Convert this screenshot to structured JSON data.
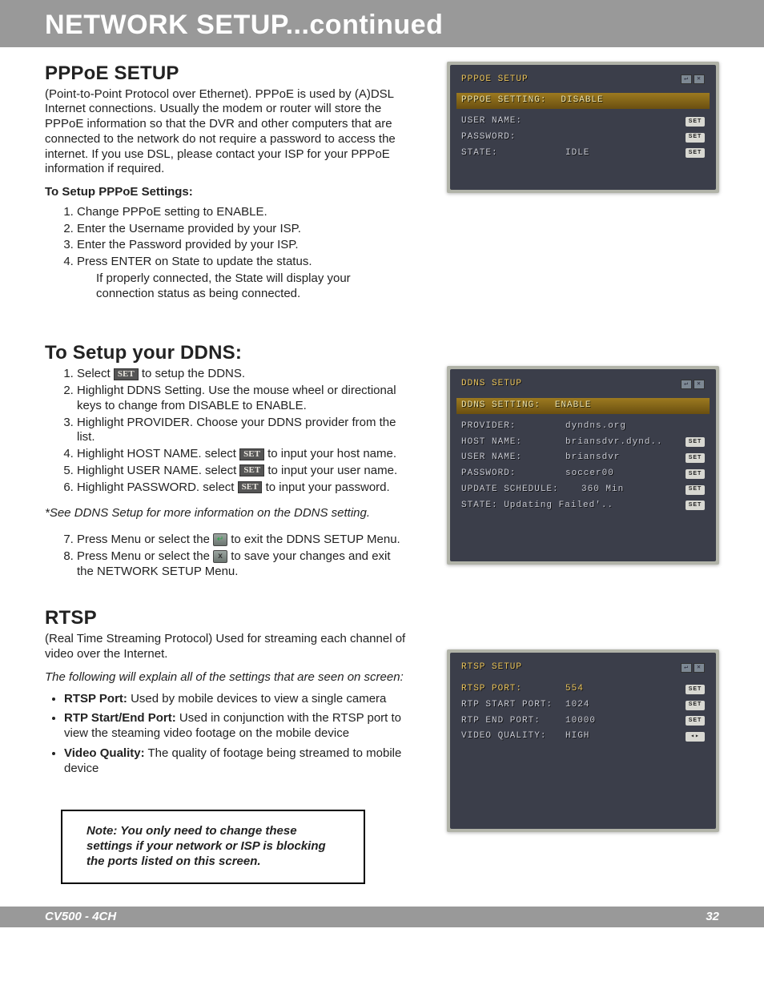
{
  "banner": {
    "title": "NETWORK SETUP...continued"
  },
  "pppoe": {
    "heading": "PPPoE SETUP",
    "desc": "(Point-to-Point Protocol over Ethernet). PPPoE is used by (A)DSL Internet connections. Usually the modem or router will store the PPPoE information so that the DVR and other computers that are connected to the network do not require a password to access the internet. If you use DSL, please contact your ISP for your PPPoE information if required.",
    "setupLabel": "To Setup PPPoE Settings:",
    "step1": "Change PPPoE setting to ENABLE.",
    "step2": "Enter the Username provided by your ISP.",
    "step3": "Enter the Password provided by your ISP.",
    "step4": "Press ENTER on State to update the status.",
    "step4b": "If properly connected, the State will display your connection status as being connected."
  },
  "ddns": {
    "heading": "To Setup your DDNS:",
    "step1a": "Select ",
    "step1b": " to setup the DDNS.",
    "step2": "Highlight DDNS Setting. Use the mouse wheel or directional keys to change from  DISABLE to ENABLE.",
    "step3": "Highlight PROVIDER. Choose your DDNS provider from the list.",
    "step4a": "Highlight HOST NAME. select ",
    "step4b": " to input your host name.",
    "step5a": "Highlight USER NAME. select ",
    "step5b": " to input your user name.",
    "step6a": "Highlight PASSWORD. select ",
    "step6b": " to input your password.",
    "note": "*See DDNS Setup for more information on the DDNS setting.",
    "step7a": "Press Menu or select the ",
    "step7b": " to exit the DDNS SETUP Menu.",
    "step8a": "Press Menu or select the ",
    "step8b": " to save your changes and exit the NETWORK SETUP Menu."
  },
  "rtsp": {
    "heading": "RTSP",
    "desc": "(Real Time Streaming Protocol) Used for streaming each channel of video over the Internet.",
    "explain": "The following will explain all of the settings that are seen on screen:",
    "b1": "RTSP Port:",
    "b1v": " Used by mobile devices to view a single camera",
    "b2": "RTP Start/End Port:",
    "b2v": " Used in conjunction with the RTSP port to view the steaming video footage on the mobile device",
    "b3": "Video Quality:",
    "b3v": " The quality of footage being streamed to mobile device"
  },
  "notebox": "Note: You only need to change these settings if your network or ISP is blocking the ports listed on this screen.",
  "footer": {
    "left": "CV500 - 4CH",
    "right": "32"
  },
  "setLabel": "SET",
  "dvr1": {
    "title": "PPPOE SETUP",
    "barLabel": "PPPOE SETTING:",
    "barValue": "DISABLE",
    "r1": "USER NAME:",
    "r2": "PASSWORD:",
    "r3": "STATE:",
    "r3v": "IDLE"
  },
  "dvr2": {
    "title": "DDNS SETUP",
    "barLabel": "DDNS SETTING:",
    "barValue": "ENABLE",
    "r1": "PROVIDER:",
    "r1v": "dyndns.org",
    "r2": "HOST NAME:",
    "r2v": "briansdvr.dynd..",
    "r3": "USER NAME:",
    "r3v": "briansdvr",
    "r4": "PASSWORD:",
    "r4v": "soccer00",
    "r5": "UPDATE SCHEDULE:",
    "r5v": "360 Min",
    "r6": "STATE: Updating Failed'.."
  },
  "dvr3": {
    "title": "RTSP SETUP",
    "r1": "RTSP PORT:",
    "r1v": "554",
    "r2": "RTP START PORT:",
    "r2v": "1024",
    "r3": "RTP END PORT:",
    "r3v": "10000",
    "r4": "VIDEO QUALITY:",
    "r4v": "HIGH"
  }
}
